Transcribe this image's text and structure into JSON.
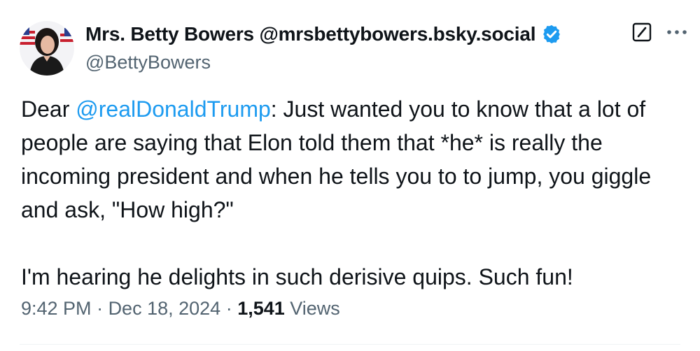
{
  "author": {
    "display_name": "Mrs. Betty Bowers @mrsbettybowers.bsky.social",
    "handle": "@BettyBowers",
    "avatar_icon": "avatar-photo",
    "verified_icon": "verified-badge-icon",
    "verified_color": "#1d9bf0"
  },
  "header_actions": {
    "grok_icon": "grok-icon",
    "more_icon": "more-options-icon"
  },
  "tweet": {
    "para1_prefix": "Dear ",
    "mention": "@realDonaldTrump",
    "para1_rest": ": Just wanted you to know that a lot of people are saying that Elon told them that *he* is really the incoming president and when he tells you to to jump, you giggle and ask, \"How high?\"",
    "para2": "I'm hearing he delights in such derisive quips. Such fun!"
  },
  "meta": {
    "time": "9:42 PM",
    "separator": " · ",
    "date": "Dec 18, 2024",
    "views_count": "1,541",
    "views_label": " Views"
  },
  "colors": {
    "text": "#0f1419",
    "secondary": "#536471",
    "link": "#1d9bf0"
  }
}
